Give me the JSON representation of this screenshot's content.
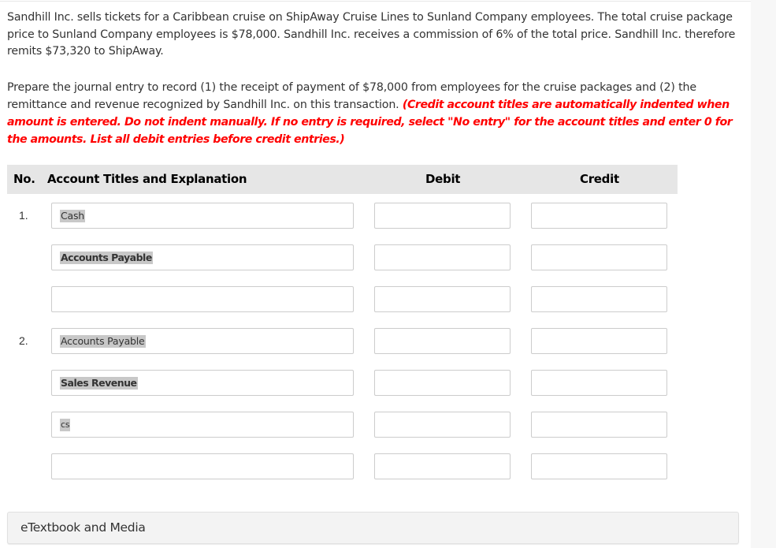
{
  "question": {
    "text": "Sandhill Inc. sells tickets for a Caribbean cruise on ShipAway Cruise Lines to Sunland Company employees. The total cruise package price to Sunland Company employees is $78,000. Sandhill Inc. receives a commission of 6% of the total price. Sandhill Inc. therefore remits $73,320 to ShipAway."
  },
  "instructions": {
    "text": "Prepare the journal entry to record (1) the receipt of payment of $78,000 from employees for the cruise packages and (2) the remittance and revenue recognized by Sandhill Inc. on this transaction. ",
    "note": "(Credit account titles are automatically indented when amount is entered. Do not indent manually. If no entry is required, select \"No entry\" for the account titles and enter 0 for the amounts. List all debit entries before credit entries.)",
    "note_color": "#ff0000"
  },
  "table": {
    "headers": {
      "no": "No.",
      "account": "Account Titles and Explanation",
      "debit": "Debit",
      "credit": "Credit"
    },
    "rows": [
      {
        "no": "1.",
        "account": "Cash",
        "debit": "",
        "credit": ""
      },
      {
        "no": "",
        "account": "Accounts Payable",
        "debit": "",
        "credit": ""
      },
      {
        "no": "",
        "account": "",
        "debit": "",
        "credit": ""
      },
      {
        "no": "2.",
        "account": "Accounts Payable",
        "debit": "",
        "credit": ""
      },
      {
        "no": "",
        "account": "Sales Revenue",
        "debit": "",
        "credit": ""
      },
      {
        "no": "",
        "account": "cs",
        "debit": "",
        "credit": ""
      },
      {
        "no": "",
        "account": "",
        "debit": "",
        "credit": ""
      }
    ]
  },
  "etextbook": {
    "label": "eTextbook and Media"
  }
}
